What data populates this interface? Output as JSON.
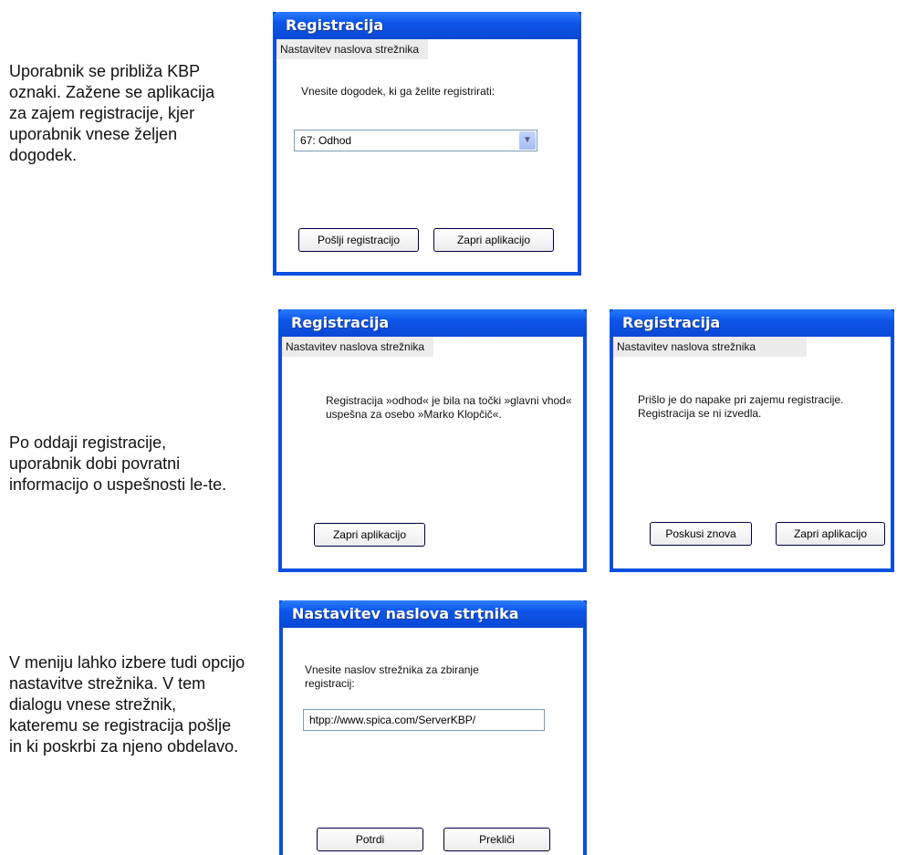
{
  "descriptions": {
    "d1": "Uporabnik se približa KBP oznaki. Zažene se aplikacija za zajem registracije, kjer uporabnik vnese željen dogodek.",
    "d2": "Po oddaji registracije, uporabnik dobi povratni informacijo o uspešnosti le-te.",
    "d3": "V meniju lahko izbere tudi opcijo nastavitve strežnika. V tem dialogu vnese strežnik, kateremu se registracija pošlje in ki poskrbi za njeno obdelavo."
  },
  "dialog1": {
    "title": "Registracija",
    "menu": "Nastavitev naslova strežnika",
    "prompt": "Vnesite dogodek, ki ga želite registrirati:",
    "select_value": "67: Odhod",
    "btn_send": "Pošlji registracijo",
    "btn_close": "Zapri aplikacijo"
  },
  "dialog2": {
    "title": "Registracija",
    "menu": "Nastavitev naslova strežnika",
    "message": "Registracija »odhod« je bila na točki »glavni vhod« uspešna za osebo »Marko Klopčič«.",
    "btn_close": "Zapri aplikacijo"
  },
  "dialog3": {
    "title": "Registracija",
    "menu": "Nastavitev naslova strežnika",
    "message": "Prišlo je do napake pri zajemu registracije. Registracija se ni izvedla.",
    "btn_retry": "Poskusi znova",
    "btn_close": "Zapri aplikacijo"
  },
  "dialog4": {
    "title": "Nastavitev naslova strţnika",
    "prompt": "Vnesite naslov strežnika za zbiranje registracij:",
    "input_value": "htpp://www.spica.com/ServerKBP/",
    "btn_confirm": "Potrdi",
    "btn_cancel": "Prekliči"
  },
  "colors": {
    "titlebar": "#0c55e8",
    "frame": "#0b4fe0"
  }
}
